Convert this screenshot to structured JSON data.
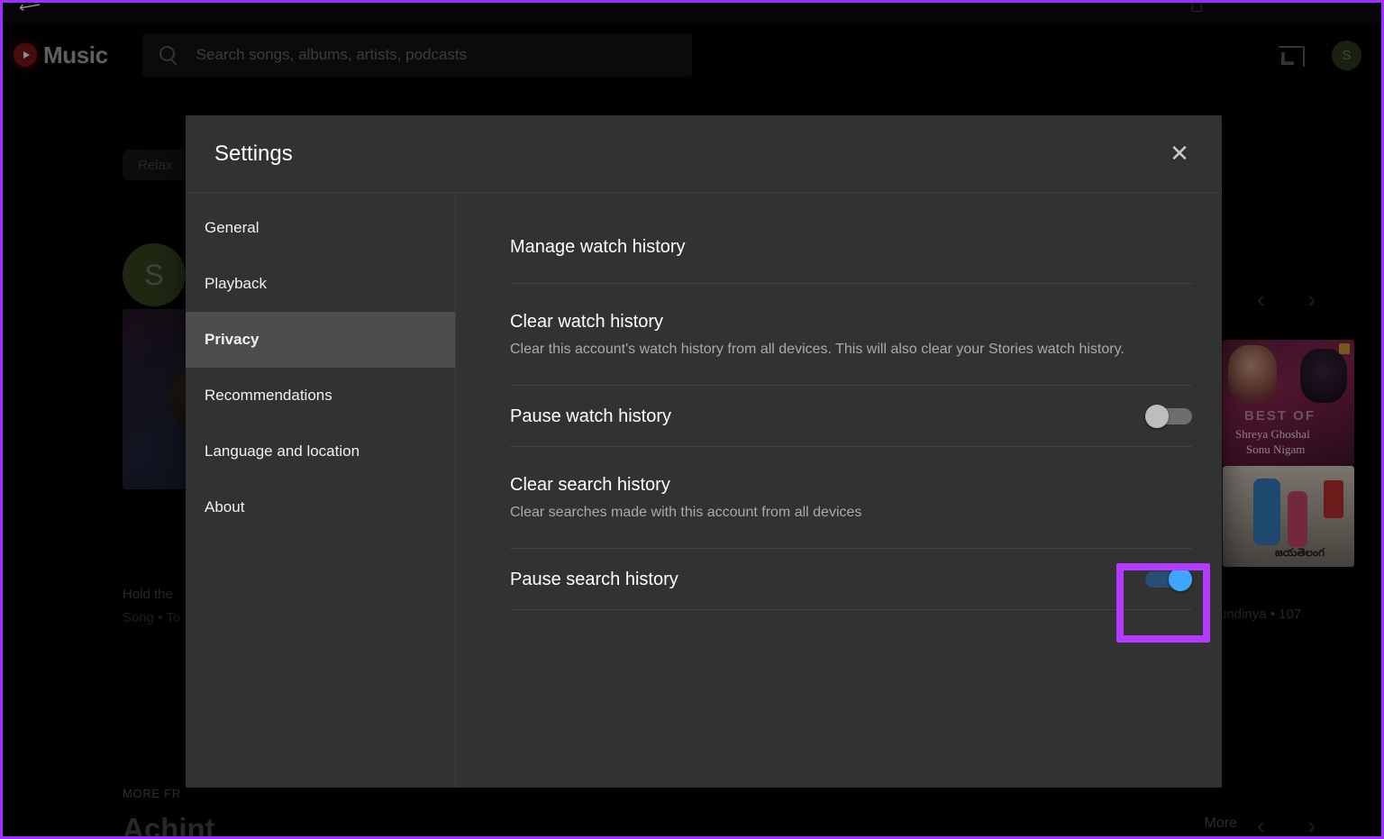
{
  "app": {
    "brand": "Music",
    "brand_logo_icon": "youtube-music-play-icon",
    "search": {
      "placeholder": "Search songs, albums, artists, podcasts",
      "icon": "search-icon"
    },
    "cast_icon": "cast-icon",
    "avatar_initial": "S",
    "chip_label": "Relax",
    "artist_avatar_initial": "S",
    "left_card_title": "Hold the",
    "left_card_subtitle": "Song • To",
    "more_from_label": "MORE FR",
    "artist_name": "Achint",
    "right_card_1": {
      "line1": "BEST OF",
      "line2": "Shreya Ghoshal",
      "line3": "Sonu Nigam"
    },
    "right_card_2": {
      "title": "జయతెలంగ"
    },
    "right_text": "undinya • 107",
    "more_button": "More",
    "prev_icon": "chevron-left-icon",
    "next_icon": "chevron-right-icon"
  },
  "dialog": {
    "title": "Settings",
    "close_icon": "close-icon",
    "nav": {
      "items": [
        {
          "label": "General",
          "active": false
        },
        {
          "label": "Playback",
          "active": false
        },
        {
          "label": "Privacy",
          "active": true
        },
        {
          "label": "Recommendations",
          "active": false
        },
        {
          "label": "Language and location",
          "active": false
        },
        {
          "label": "About",
          "active": false
        }
      ]
    },
    "settings": [
      {
        "title": "Manage watch history",
        "desc": "",
        "toggle": null
      },
      {
        "title": "Clear watch history",
        "desc": "Clear this account's watch history from all devices. This will also clear your Stories watch history.",
        "toggle": null
      },
      {
        "title": "Pause watch history",
        "desc": "",
        "toggle": "off"
      },
      {
        "title": "Clear search history",
        "desc": "Clear searches made with this account from all devices",
        "toggle": null
      },
      {
        "title": "Pause search history",
        "desc": "",
        "toggle": "on"
      }
    ]
  },
  "annotation": {
    "color": "#b13bff",
    "target": "pause-search-history-toggle"
  },
  "colors": {
    "dialog_bg": "#323232",
    "nav_active_bg": "#4d4d4d",
    "toggle_on": "#3ea6ff",
    "toggle_off": "#bdbdbd",
    "highlight": "#b13bff",
    "brand_red": "#6d1316"
  }
}
